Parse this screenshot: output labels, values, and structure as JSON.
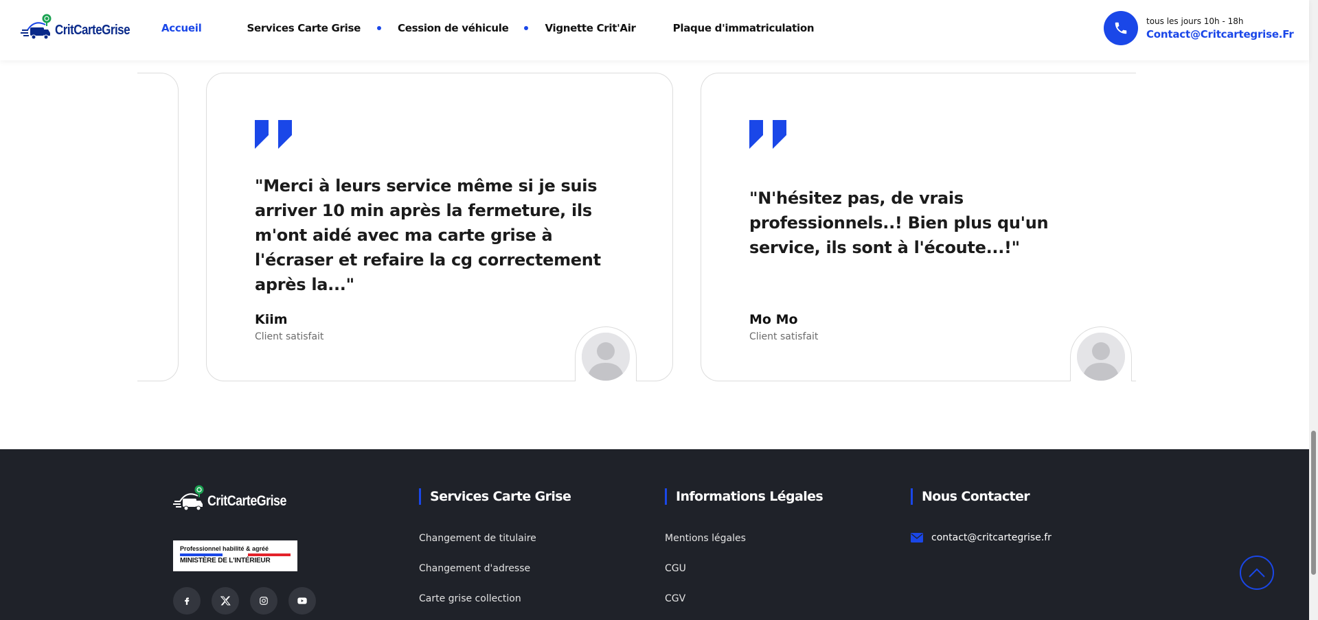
{
  "header": {
    "logo_text": "CritCarteGrise",
    "nav": [
      {
        "label": "Accueil",
        "active": true
      },
      {
        "label": "Services Carte Grise",
        "active": false
      },
      {
        "label": "Cession de véhicule",
        "active": false
      },
      {
        "label": "Vignette Crit'Air",
        "active": false
      },
      {
        "label": "Plaque d'immatriculation",
        "active": false
      }
    ],
    "contact": {
      "hours": "tous les jours 10h - 18h",
      "email": "Contact@Critcartegrise.Fr"
    }
  },
  "testimonials": [
    {
      "quote": "\"Merci à leurs service même si je suis arriver 10 min après la fermeture, ils m'ont aidé avec ma carte grise à l'écraser et refaire la cg correctement après la...\"",
      "author": "Kiim",
      "role": "Client satisfait"
    },
    {
      "quote": "\"N'hésitez pas, de vrais professionnels..! Bien plus qu'un service, ils sont à l'écoute...!\"",
      "author": "Mo Mo",
      "role": "Client satisfait"
    }
  ],
  "footer": {
    "logo_text": "CritCarteGrise",
    "badge_top": "Professionnel habilité & agréé",
    "badge_bottom": "MINISTÈRE DE L'INTÉRIEUR",
    "socials": [
      "facebook-icon",
      "x-icon",
      "instagram-icon",
      "youtube-icon"
    ],
    "columns": [
      {
        "title": "Services Carte Grise",
        "links": [
          "Changement de titulaire",
          "Changement d'adresse",
          "Carte grise collection"
        ]
      },
      {
        "title": "Informations Légales",
        "links": [
          "Mentions légales",
          "CGU",
          "CGV"
        ]
      },
      {
        "title": "Nous Contacter",
        "email": "contact@critcartegrise.fr"
      }
    ]
  },
  "colors": {
    "accent": "#1a47e8",
    "footer_bg": "#1f2229"
  }
}
